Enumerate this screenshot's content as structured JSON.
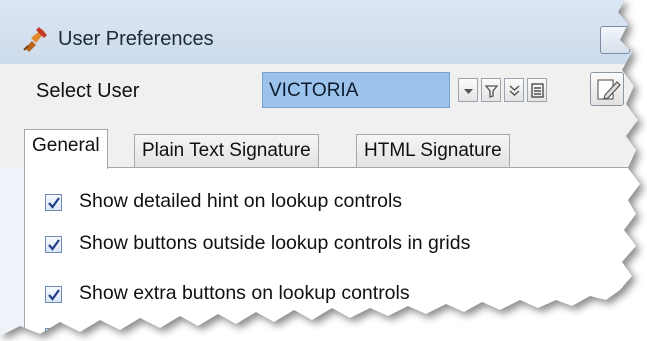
{
  "window": {
    "title": "User Preferences",
    "icon": "satellite-icon"
  },
  "user_selector": {
    "label": "Select User",
    "value": "VICTORIA",
    "buttons": [
      "dropdown-icon",
      "filter-icon",
      "double-chevron-down-icon",
      "list-icon"
    ],
    "edit_icon": "edit-icon"
  },
  "tabs": [
    {
      "label": "General",
      "active": true
    },
    {
      "label": "Plain Text Signature",
      "active": false
    },
    {
      "label": "HTML Signature",
      "active": false
    }
  ],
  "options": [
    {
      "label": "Show detailed hint on lookup controls",
      "checked": true,
      "highlighted": false
    },
    {
      "label": "Show buttons outside lookup controls in grids",
      "checked": true,
      "highlighted": true
    },
    {
      "label": "Show extra buttons on lookup controls",
      "checked": true,
      "highlighted": false
    },
    {
      "label": "",
      "checked": false,
      "highlighted": false
    }
  ],
  "colors": {
    "highlight": "#f3f32a",
    "selected_field": "#9cc3ec",
    "titlebar": "#d5e1ef"
  }
}
